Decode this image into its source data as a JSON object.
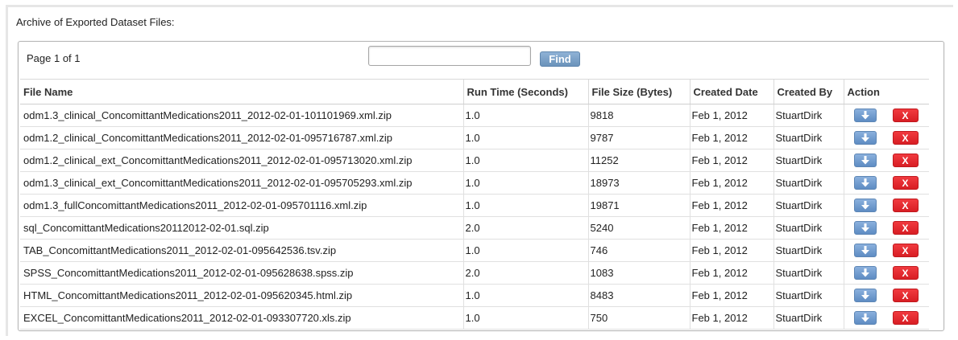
{
  "archive_title": "Archive of Exported Dataset Files:",
  "pagination": {
    "label": "Page 1 of 1"
  },
  "search": {
    "value": "",
    "placeholder": "",
    "button_label": "Find"
  },
  "table": {
    "headers": [
      "File Name",
      "Run Time (Seconds)",
      "File Size (Bytes)",
      "Created Date",
      "Created By",
      "Action"
    ],
    "rows": [
      {
        "file_name": "odm1.3_clinical_ConcomittantMedications2011_2012-02-01-101101969.xml.zip",
        "run_time": "1.0",
        "file_size": "9818",
        "created_date": "Feb 1, 2012",
        "created_by": "StuartDirk"
      },
      {
        "file_name": "odm1.2_clinical_ConcomittantMedications2011_2012-02-01-095716787.xml.zip",
        "run_time": "1.0",
        "file_size": "9787",
        "created_date": "Feb 1, 2012",
        "created_by": "StuartDirk"
      },
      {
        "file_name": "odm1.2_clinical_ext_ConcomittantMedications2011_2012-02-01-095713020.xml.zip",
        "run_time": "1.0",
        "file_size": "11252",
        "created_date": "Feb 1, 2012",
        "created_by": "StuartDirk"
      },
      {
        "file_name": "odm1.3_clinical_ext_ConcomittantMedications2011_2012-02-01-095705293.xml.zip",
        "run_time": "1.0",
        "file_size": "18973",
        "created_date": "Feb 1, 2012",
        "created_by": "StuartDirk"
      },
      {
        "file_name": "odm1.3_fullConcomittantMedications2011_2012-02-01-095701116.xml.zip",
        "run_time": "1.0",
        "file_size": "19871",
        "created_date": "Feb 1, 2012",
        "created_by": "StuartDirk"
      },
      {
        "file_name": "sql_ConcomittantMedications20112012-02-01.sql.zip",
        "run_time": "2.0",
        "file_size": "5240",
        "created_date": "Feb 1, 2012",
        "created_by": "StuartDirk"
      },
      {
        "file_name": "TAB_ConcomittantMedications2011_2012-02-01-095642536.tsv.zip",
        "run_time": "1.0",
        "file_size": "746",
        "created_date": "Feb 1, 2012",
        "created_by": "StuartDirk"
      },
      {
        "file_name": "SPSS_ConcomittantMedications2011_2012-02-01-095628638.spss.zip",
        "run_time": "2.0",
        "file_size": "1083",
        "created_date": "Feb 1, 2012",
        "created_by": "StuartDirk"
      },
      {
        "file_name": "HTML_ConcomittantMedications2011_2012-02-01-095620345.html.zip",
        "run_time": "1.0",
        "file_size": "8483",
        "created_date": "Feb 1, 2012",
        "created_by": "StuartDirk"
      },
      {
        "file_name": "EXCEL_ConcomittantMedications2011_2012-02-01-093307720.xls.zip",
        "run_time": "1.0",
        "file_size": "750",
        "created_date": "Feb 1, 2012",
        "created_by": "StuartDirk"
      }
    ],
    "actions": {
      "download_icon": "download-arrow-icon",
      "delete_label": "X"
    }
  },
  "colors": {
    "find_button": "#6b93bb",
    "download_button": "#5e8cc3",
    "delete_button": "#d81e24",
    "border": "#b7b7b7"
  }
}
